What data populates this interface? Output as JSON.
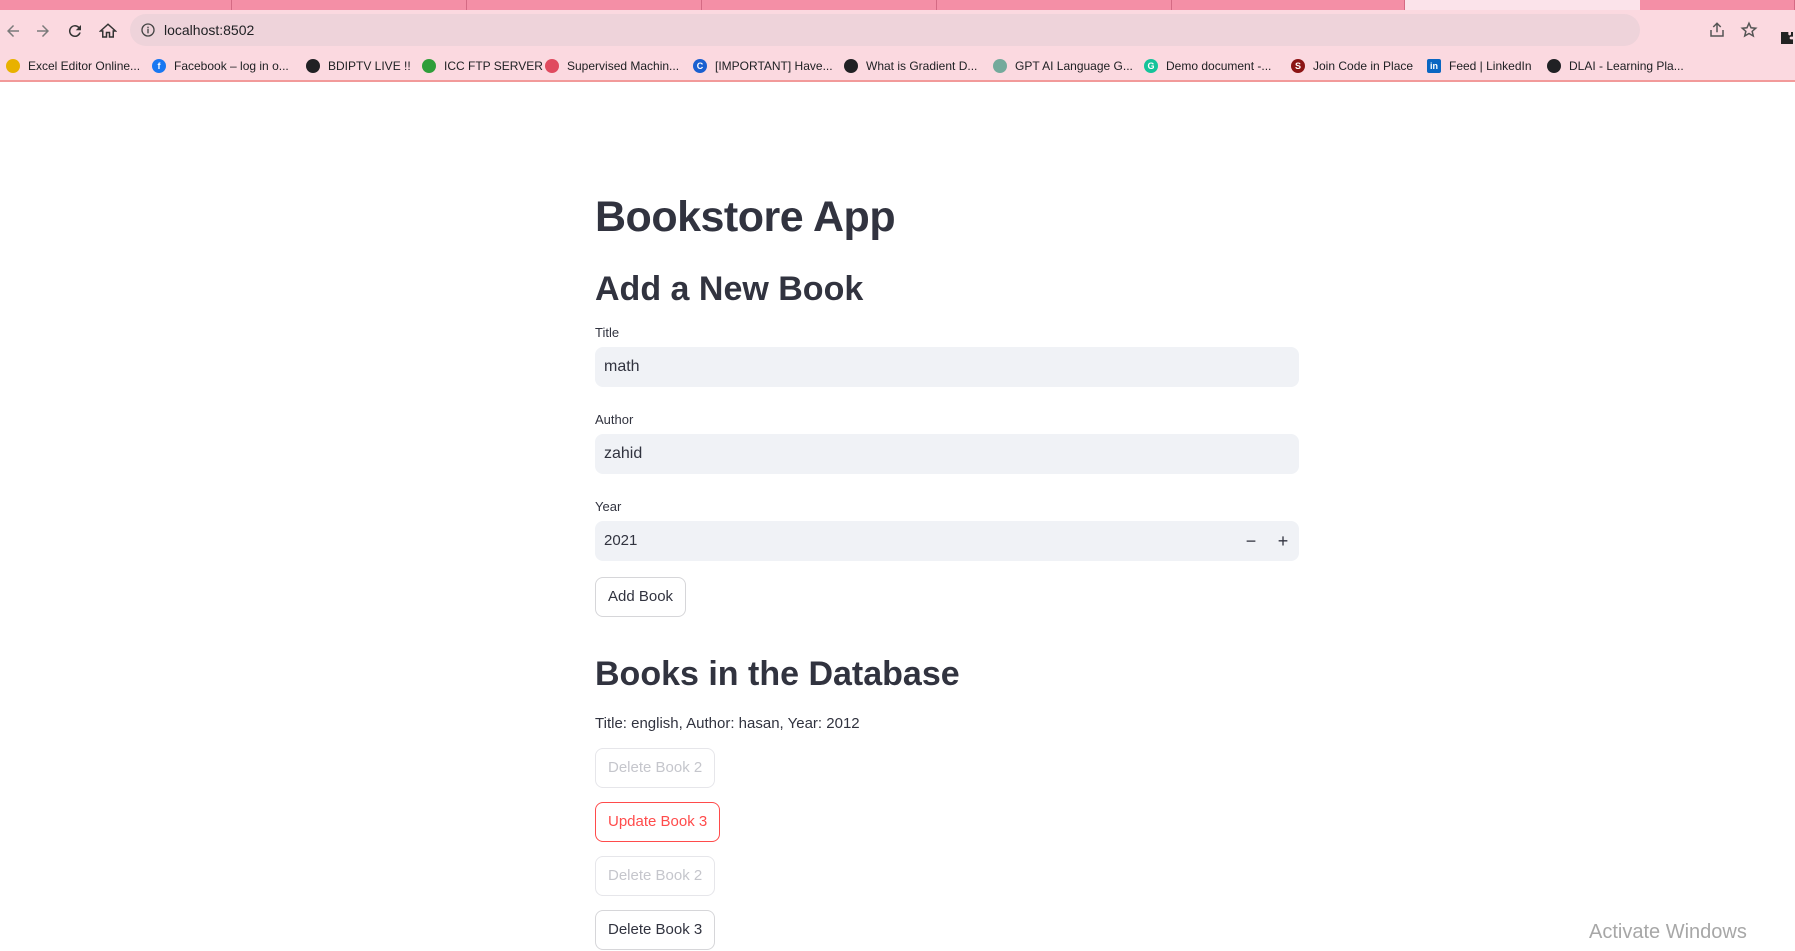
{
  "browser": {
    "url": "localhost:8502",
    "bookmarks": [
      {
        "label": "Excel Editor Online...",
        "icon": "chrome-icon",
        "color": "#e8b100"
      },
      {
        "label": "Facebook – log in o...",
        "icon": "facebook-icon",
        "color": "#1877f2"
      },
      {
        "label": "BDIPTV LIVE !!",
        "icon": "globe-icon",
        "color": "#202124"
      },
      {
        "label": "ICC FTP SERVER",
        "icon": "leaf-icon",
        "color": "#2e9e3a"
      },
      {
        "label": "Supervised Machin...",
        "icon": "target-icon",
        "color": "#e04a5f"
      },
      {
        "label": "[IMPORTANT] Have...",
        "icon": "c-icon",
        "color": "#1a5fd0"
      },
      {
        "label": "What is Gradient D...",
        "icon": "network-icon",
        "color": "#202124"
      },
      {
        "label": "GPT AI Language G...",
        "icon": "openai-icon",
        "color": "#74aa9c"
      },
      {
        "label": "Demo document -...",
        "icon": "grammarly-icon",
        "color": "#15c39a"
      },
      {
        "label": "Join Code in Place",
        "icon": "stanford-icon",
        "color": "#8c1515"
      },
      {
        "label": "Feed | LinkedIn",
        "icon": "linkedin-icon",
        "color": "#0a66c2"
      },
      {
        "label": "DLAI - Learning Pla...",
        "icon": "globe-icon",
        "color": "#202124"
      }
    ]
  },
  "app": {
    "title": "Bookstore App",
    "add_section": {
      "heading": "Add a New Book",
      "title_label": "Title",
      "title_value": "math",
      "author_label": "Author",
      "author_value": "zahid",
      "year_label": "Year",
      "year_value": "2021",
      "minus": "−",
      "plus": "+",
      "add_button": "Add Book"
    },
    "db_section": {
      "heading": "Books in the Database",
      "book_line": "Title: english, Author: hasan, Year: 2012",
      "buttons": [
        "Delete Book 2",
        "Update Book 3",
        "Delete Book 2",
        "Delete Book 3"
      ]
    }
  },
  "os": {
    "watermark": "Activate Windows"
  },
  "colors": {
    "accent": "#ff4b4b",
    "input_bg": "#f0f2f6",
    "text": "#31333f"
  }
}
